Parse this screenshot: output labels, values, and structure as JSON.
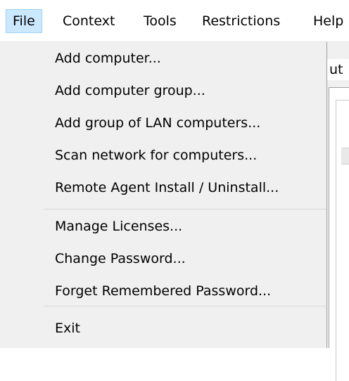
{
  "menubar": {
    "items": [
      {
        "label": "File",
        "active": true
      },
      {
        "label": "Context",
        "active": false
      },
      {
        "label": "Tools",
        "active": false
      },
      {
        "label": "Restrictions",
        "active": false
      },
      {
        "label": "Help",
        "active": false
      }
    ]
  },
  "file_menu": {
    "groups": [
      [
        {
          "label": "Add computer..."
        },
        {
          "label": "Add computer group..."
        },
        {
          "label": "Add group of LAN computers..."
        },
        {
          "label": "Scan network for computers..."
        },
        {
          "label": "Remote Agent Install / Uninstall..."
        }
      ],
      [
        {
          "label": "Manage Licenses..."
        },
        {
          "label": "Change Password..."
        },
        {
          "label": "Forget Remembered Password..."
        }
      ],
      [
        {
          "label": "Exit"
        }
      ]
    ]
  },
  "background": {
    "tab_fragment": "ut"
  },
  "colors": {
    "menu_background": "#f0f0f0",
    "active_item_background": "#cce8ff",
    "active_item_border": "#99d1ff",
    "separator": "#d7d7d7"
  }
}
